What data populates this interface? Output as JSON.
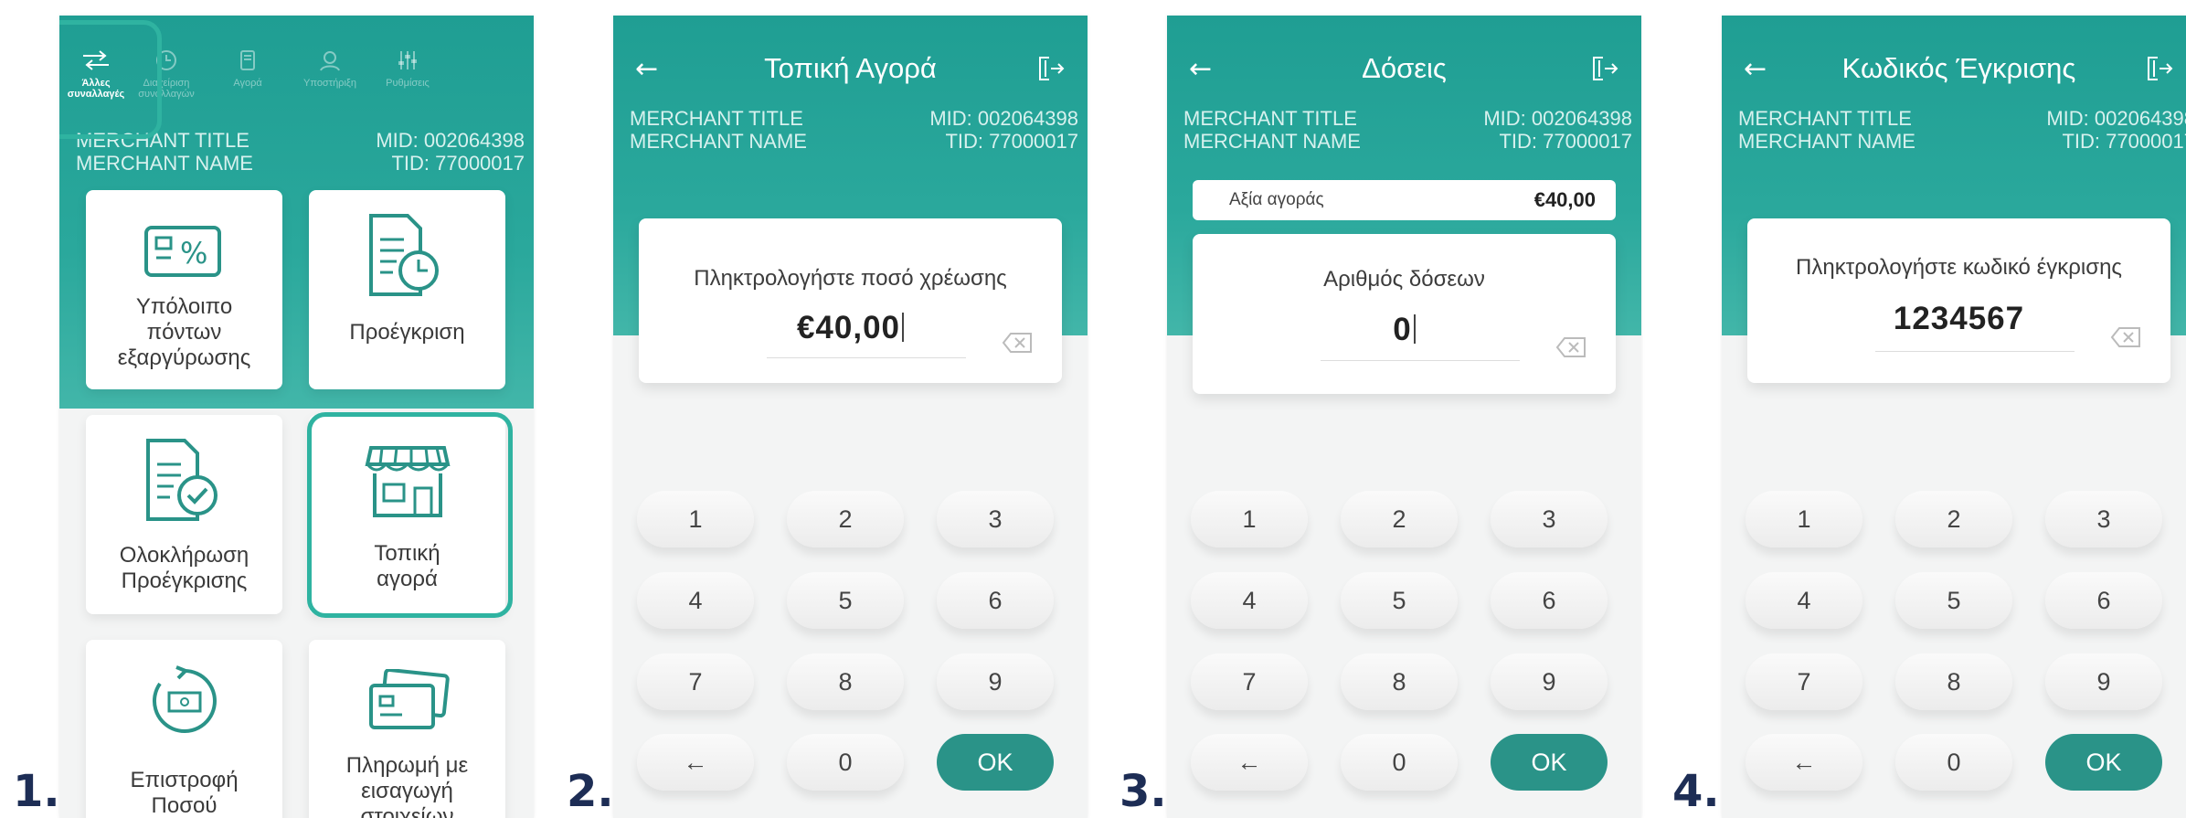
{
  "panels": [
    {
      "number": "1."
    },
    {
      "number": "2."
    },
    {
      "number": "3."
    },
    {
      "number": "4."
    }
  ],
  "merchant": {
    "title": "MERCHANT TITLE",
    "name": "MERCHANT NAME",
    "mid": "MID: 002064398",
    "tid": "TID: 77000017"
  },
  "screen1": {
    "nav": [
      {
        "label": "Άλλες συναλλαγές",
        "icon": "arrows-icon",
        "active": true
      },
      {
        "label": "Διαχείριση συναλλαγών",
        "icon": "clock-icon"
      },
      {
        "label": "Αγορά",
        "icon": "card-icon"
      },
      {
        "label": "Υποστήριξη",
        "icon": "support-icon"
      },
      {
        "label": "Ρυθμίσεις",
        "icon": "settings-icon"
      }
    ],
    "tiles": [
      {
        "label": "Υπόλοιπο πόντων εξαργύρωσης",
        "icon": "percent-card-icon"
      },
      {
        "label": "Προέγκριση",
        "icon": "document-clock-icon"
      },
      {
        "label": "Ολοκλήρωση Προέγκρισης",
        "icon": "document-check-icon"
      },
      {
        "label": "Τοπική αγορά",
        "icon": "store-icon"
      },
      {
        "label": "Επιστροφή Ποσού",
        "icon": "refund-icon"
      },
      {
        "label": "Πληρωμή με εισαγωγή στοιχείων κάρτας",
        "icon": "cards-icon"
      }
    ]
  },
  "screen2": {
    "title": "Τοπική Αγορά",
    "prompt": "Πληκτρολογήστε ποσό χρέωσης",
    "value": "€40,00"
  },
  "screen3": {
    "title": "Δόσεις",
    "summary_label": "Αξία αγοράς",
    "summary_value": "€40,00",
    "prompt": "Αριθμός δόσεων",
    "value": "0"
  },
  "screen4": {
    "title": "Κωδικός Έγκρισης",
    "prompt": "Πληκτρολογήστε κωδικό έγκρισης",
    "value": "1234567"
  },
  "keypad": {
    "keys": [
      "1",
      "2",
      "3",
      "4",
      "5",
      "6",
      "7",
      "8",
      "9",
      "←",
      "0",
      "OK"
    ]
  },
  "icons": {
    "back": "arrow-left-icon",
    "exit": "exit-icon",
    "backspace": "backspace-icon"
  },
  "colors": {
    "teal": "#2aa89c",
    "ok_button": "#2a9388",
    "highlight": "#2fb3a1",
    "panel_number": "#1d2d55"
  }
}
